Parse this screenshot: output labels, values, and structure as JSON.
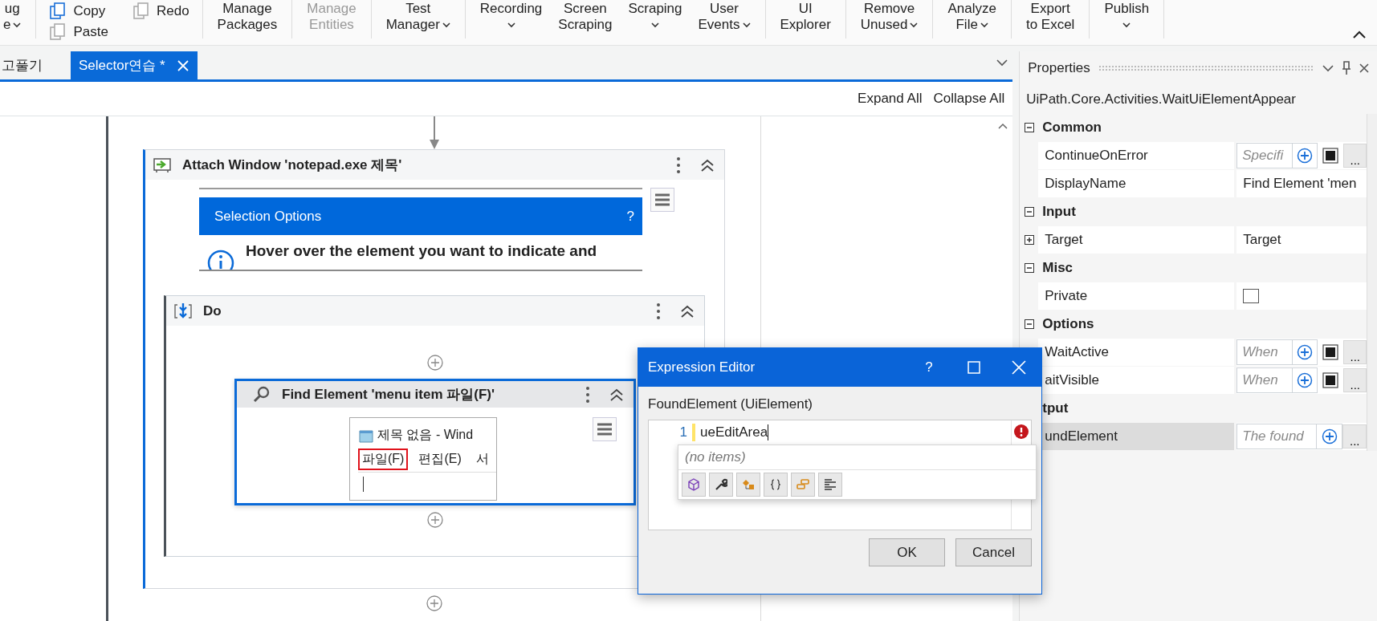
{
  "ribbon": {
    "groups": [
      {
        "items": [
          {
            "kind": "large",
            "lines": [
              "ug",
              "e"
            ],
            "dropdown": true,
            "disabled": false
          }
        ]
      },
      {
        "items": [
          {
            "kind": "small",
            "label": "Copy",
            "disabled": false
          },
          {
            "kind": "small",
            "label": "Paste",
            "disabled": true
          },
          {
            "kind": "small",
            "label": "Redo",
            "disabled": true
          }
        ]
      },
      {
        "items": [
          {
            "kind": "large",
            "lines": [
              "Manage",
              "Packages"
            ],
            "dropdown": false,
            "disabled": false
          }
        ]
      },
      {
        "items": [
          {
            "kind": "large",
            "lines": [
              "Manage",
              "Entities"
            ],
            "dropdown": false,
            "disabled": true
          }
        ]
      },
      {
        "items": [
          {
            "kind": "large",
            "lines": [
              "Test",
              "Manager"
            ],
            "dropdown": true,
            "disabled": false
          }
        ]
      },
      {
        "items": [
          {
            "kind": "large",
            "lines": [
              "Recording"
            ],
            "dropdown": true,
            "disabled": false
          },
          {
            "kind": "large",
            "lines": [
              "Screen",
              "Scraping"
            ],
            "dropdown": false,
            "disabled": false
          },
          {
            "kind": "large",
            "lines": [
              "Scraping"
            ],
            "dropdown": true,
            "disabled": false
          },
          {
            "kind": "large",
            "lines": [
              "User",
              "Events"
            ],
            "dropdown": true,
            "disabled": false
          }
        ]
      },
      {
        "items": [
          {
            "kind": "large",
            "lines": [
              "UI",
              "Explorer"
            ],
            "dropdown": false,
            "disabled": false
          }
        ]
      },
      {
        "items": [
          {
            "kind": "large",
            "lines": [
              "Remove",
              "Unused"
            ],
            "dropdown": true,
            "disabled": false
          }
        ]
      },
      {
        "items": [
          {
            "kind": "large",
            "lines": [
              "Analyze",
              "File"
            ],
            "dropdown": true,
            "disabled": false
          }
        ]
      },
      {
        "items": [
          {
            "kind": "large",
            "lines": [
              "Export",
              "to Excel"
            ],
            "dropdown": false,
            "disabled": false
          }
        ]
      },
      {
        "items": [
          {
            "kind": "large",
            "lines": [
              "Publish"
            ],
            "dropdown": true,
            "disabled": false
          }
        ]
      }
    ]
  },
  "tabs": [
    {
      "label": "고풀기",
      "selected": false
    },
    {
      "label": "Selector연습 *",
      "selected": true
    }
  ],
  "designer": {
    "expand_all": "Expand All",
    "collapse_all": "Collapse All",
    "attach": {
      "title": "Attach Window 'notepad.exe 제목'",
      "selection_options": {
        "title": "Selection Options",
        "help": "?"
      },
      "hint": "Hover over the element you want to indicate and",
      "do": {
        "title": "Do",
        "find": {
          "title": "Find Element 'menu item  파일(F)'",
          "preview": {
            "window_title": "제목 없음 - Wind",
            "menu": [
              {
                "label": "파일(F)",
                "selected": true
              },
              {
                "label": "편집(E)",
                "selected": false
              },
              {
                "label": "서",
                "selected": false
              }
            ]
          }
        }
      }
    }
  },
  "properties": {
    "title": "Properties",
    "type_name": "UiPath.Core.Activities.WaitUiElementAppear",
    "rows": [
      {
        "kind": "category",
        "label": "Common",
        "expanded": true
      },
      {
        "kind": "in-argument",
        "label": "ContinueOnError",
        "placeholder": "Specifi",
        "browse": "...",
        "selected": false
      },
      {
        "kind": "text",
        "label": "DisplayName",
        "value": "Find Element 'men",
        "selected": false
      },
      {
        "kind": "category",
        "label": "Input",
        "expanded": true
      },
      {
        "kind": "expandable",
        "label": "Target",
        "value": "Target",
        "expanded": false,
        "selected": false
      },
      {
        "kind": "category",
        "label": "Misc",
        "expanded": true
      },
      {
        "kind": "checkbox",
        "label": "Private",
        "checked": false,
        "selected": false
      },
      {
        "kind": "category",
        "label": "Options",
        "expanded": true
      },
      {
        "kind": "in-argument",
        "label": "WaitActive",
        "placeholder": "When",
        "browse": "...",
        "selected": false
      },
      {
        "kind": "in-argument",
        "label": "aitVisible",
        "placeholder": "When",
        "browse": "...",
        "selected": false
      },
      {
        "kind": "category",
        "label": "tput"
      },
      {
        "kind": "out-argument",
        "label": "undElement",
        "placeholder": "The found",
        "browse": "...",
        "selected": true
      }
    ]
  },
  "expression_editor": {
    "title": "Expression Editor",
    "help": "?",
    "label": "FoundElement (UiElement)",
    "lines": [
      {
        "number": "1",
        "text": "ueEditArea"
      }
    ],
    "error": true,
    "autocomplete": {
      "empty_text": "(no items)"
    },
    "buttons": [
      "OK",
      "Cancel"
    ]
  }
}
